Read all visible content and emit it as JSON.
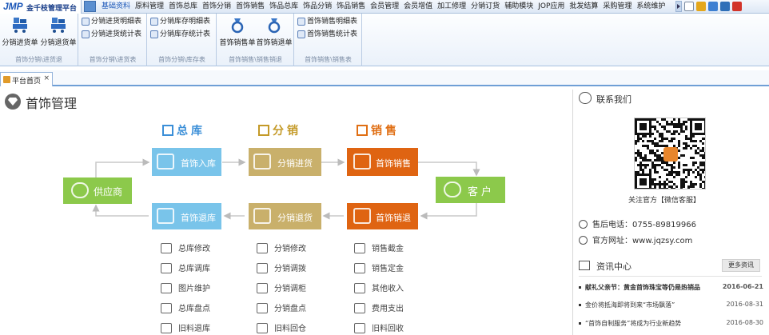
{
  "app": {
    "logo": "JMP",
    "name": "金千枝管理平台"
  },
  "menu": [
    "基础资料",
    "原料管理",
    "首饰总库",
    "首饰分销",
    "首饰销售",
    "饰品总库",
    "饰品分销",
    "饰品销售",
    "会员管理",
    "会员增值",
    "加工修理",
    "分销订货",
    "辅助模块",
    "JOP应用",
    "批发结算",
    "采购管理",
    "系统维护"
  ],
  "ribbon": {
    "groups": [
      {
        "label": "首饰分销\\进货退",
        "buttons": [
          {
            "label": "分销进货单"
          },
          {
            "label": "分销退货单"
          }
        ]
      },
      {
        "label": "首饰分销\\进货表",
        "items": [
          {
            "label": "分销进货明细表"
          },
          {
            "label": "分销进货统计表"
          }
        ]
      },
      {
        "label": "首饰分销\\库存表",
        "items": [
          {
            "label": "分销库存明细表"
          },
          {
            "label": "分销库存统计表"
          }
        ]
      },
      {
        "label": "首饰销售\\销售销退",
        "buttons": [
          {
            "label": "首饰销售单"
          },
          {
            "label": "首饰销退单"
          }
        ]
      },
      {
        "label": "首饰销售\\销售表",
        "items": [
          {
            "label": "首饰销售明细表"
          },
          {
            "label": "首饰销售统计表"
          }
        ]
      }
    ]
  },
  "tabs": [
    {
      "label": "平台首页",
      "close": "×"
    }
  ],
  "page": {
    "title": "首饰管理"
  },
  "flow": {
    "categories": [
      {
        "label": "总库",
        "color": "#3b8fd8"
      },
      {
        "label": "分销",
        "color": "#c49a28"
      },
      {
        "label": "销售",
        "color": "#e06f14"
      }
    ],
    "supplier": "供应商",
    "customer": "客户",
    "boxes": {
      "in_stock": "首饰入库",
      "dist_in": "分销进货",
      "sale": "首饰销售",
      "return_stock": "首饰退库",
      "dist_return": "分销退货",
      "sale_return": "首饰销退"
    },
    "colors": {
      "blue": "#79c4ea",
      "tan": "#c9b06b",
      "orange": "#df6412",
      "green": "#8cc94b"
    },
    "sub": {
      "col1": [
        "总库修改",
        "总库调库",
        "图片维护",
        "总库盘点",
        "旧料退库"
      ],
      "col2": [
        "分销修改",
        "分销调拨",
        "分销调柜",
        "分销盘点",
        "旧料回仓"
      ],
      "col3": [
        "销售截金",
        "销售定金",
        "其他收入",
        "费用支出",
        "旧料回收"
      ]
    }
  },
  "contact": {
    "title": "联系我们",
    "qr_caption": "关注官方【微信客服】",
    "phone_label": "售后电话：",
    "phone": "0755-89819966",
    "site_label": "官方网址：",
    "site": "www.jqzsy.com"
  },
  "news": {
    "title": "资讯中心",
    "more": "更多资讯",
    "items": [
      {
        "title": "献礼父亲节：黄金首饰珠宝等仍是热销品",
        "date": "2016-06-21",
        "bold": true
      },
      {
        "title": "金价将抵海即将到来“市场飘落”",
        "date": "2016-08-31",
        "bold": false
      },
      {
        "title": "“首饰自制服务”将成为行业新趋势",
        "date": "2016-08-30",
        "bold": false
      }
    ]
  }
}
